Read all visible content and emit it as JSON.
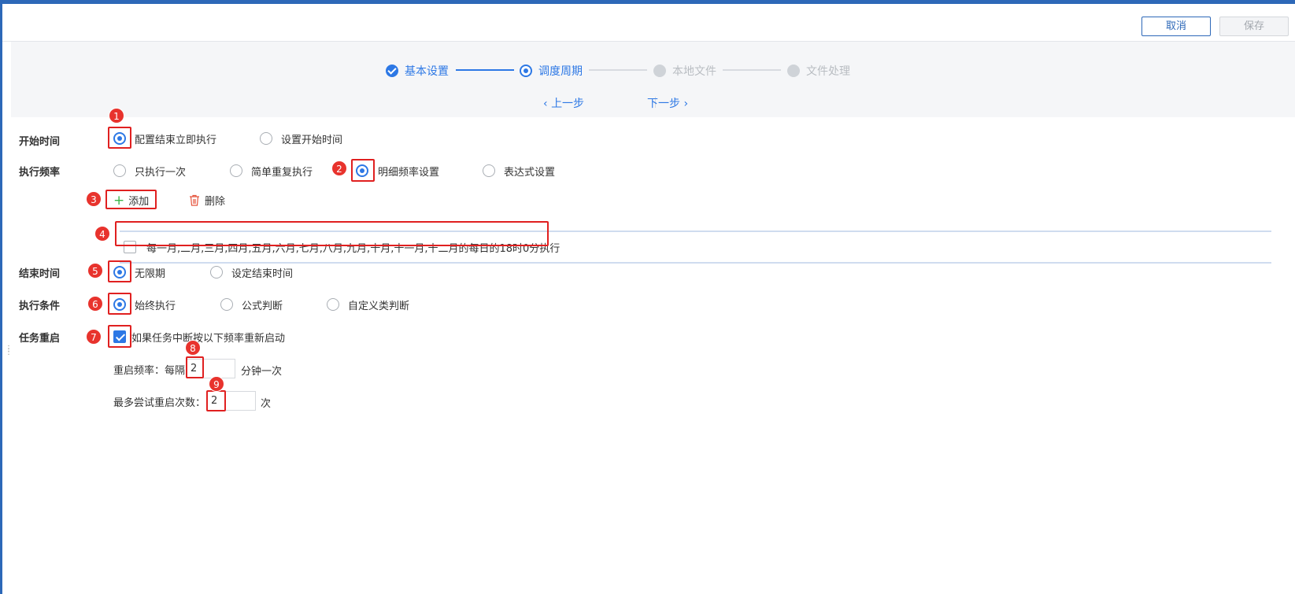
{
  "header": {
    "cancel": "取消",
    "save": "保存"
  },
  "steps": [
    {
      "label": "基本设置",
      "state": "done"
    },
    {
      "label": "调度周期",
      "state": "current"
    },
    {
      "label": "本地文件",
      "state": "todo"
    },
    {
      "label": "文件处理",
      "state": "todo"
    }
  ],
  "nav": {
    "prev": "上一步",
    "next": "下一步"
  },
  "start_time": {
    "label": "开始时间",
    "options": [
      "配置结束立即执行",
      "设置开始时间"
    ],
    "selected": "配置结束立即执行"
  },
  "frequency": {
    "label": "执行频率",
    "options": [
      "只执行一次",
      "简单重复执行",
      "明细频率设置",
      "表达式设置"
    ],
    "selected": "明细频率设置"
  },
  "toolbar": {
    "add": "添加",
    "delete": "删除"
  },
  "schedule_items": [
    "每一月,二月,三月,四月,五月,六月,七月,八月,九月,十月,十一月,十二月的每日的18时0分执行"
  ],
  "end_time": {
    "label": "结束时间",
    "options": [
      "无限期",
      "设定结束时间"
    ],
    "selected": "无限期"
  },
  "condition": {
    "label": "执行条件",
    "options": [
      "始终执行",
      "公式判断",
      "自定义类判断"
    ],
    "selected": "始终执行"
  },
  "restart": {
    "label": "任务重启",
    "checkbox_label": "如果任务中断按以下频率重新启动",
    "checked": true,
    "interval_prefix": "重启频率：每隔",
    "interval_value": "2",
    "interval_suffix": "分钟一次",
    "max_prefix": "最多尝试重启次数：",
    "max_value": "2",
    "max_suffix": "次"
  },
  "badges": [
    "1",
    "2",
    "3",
    "4",
    "5",
    "6",
    "7",
    "8",
    "9"
  ],
  "colors": {
    "accent": "#2d78e5",
    "annotation": "#e02020",
    "add_icon": "#3bb54a",
    "delete_icon": "#e5533c"
  }
}
